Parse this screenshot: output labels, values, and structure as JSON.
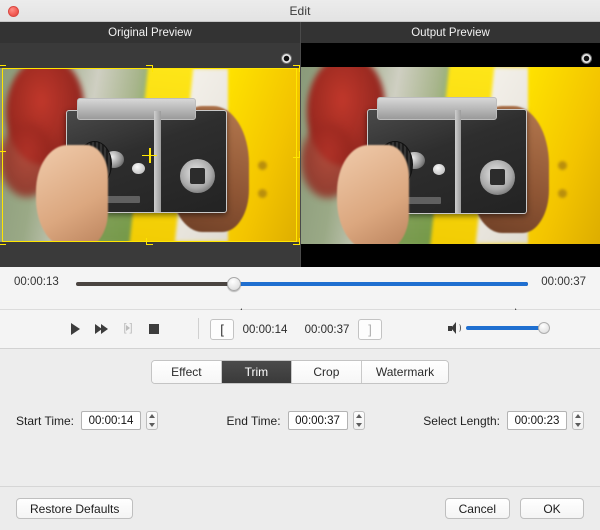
{
  "window": {
    "title": "Edit",
    "close_label": "",
    "close_icon": "close-traffic-light"
  },
  "previews": {
    "original": {
      "header": "Original Preview",
      "crop_overlay": true,
      "crosshair_icon": "crosshair-icon",
      "pin_icon": "rotation-pin-icon"
    },
    "output": {
      "header": "Output Preview",
      "letterboxed": true,
      "pin_icon": "rotation-pin-icon"
    }
  },
  "timeline": {
    "start_label": "00:00:13",
    "end_label": "00:00:37",
    "playhead_percent": 35,
    "fill_start_percent": 35,
    "fill_end_percent": 100,
    "trim_in_percent": 35,
    "trim_out_percent": 99,
    "track_color": "#1f6fd0",
    "base_color": "#4a4440"
  },
  "transport": {
    "buttons": [
      {
        "name": "play-button",
        "icon": "play-icon",
        "enabled": true
      },
      {
        "name": "fast-forward-button",
        "icon": "fast-forward-icon",
        "enabled": true
      },
      {
        "name": "step-frame-button",
        "icon": "step-frame-icon",
        "enabled": false
      },
      {
        "name": "stop-button",
        "icon": "stop-icon",
        "enabled": true
      }
    ],
    "mark_in_label": "[",
    "mark_out_label": "]",
    "in_time": "00:00:14",
    "out_time": "00:00:37",
    "volume_icon": "speaker-icon",
    "volume_percent": 100
  },
  "tabs": {
    "items": [
      {
        "label": "Effect",
        "active": false
      },
      {
        "label": "Trim",
        "active": true
      },
      {
        "label": "Crop",
        "active": false
      },
      {
        "label": "Watermark",
        "active": false
      }
    ]
  },
  "form": {
    "start_time": {
      "label": "Start Time:",
      "value": "00:00:14"
    },
    "end_time": {
      "label": "End Time:",
      "value": "00:00:37"
    },
    "select_length": {
      "label": "Select Length:",
      "value": "00:00:23"
    }
  },
  "footer": {
    "restore_defaults": "Restore Defaults",
    "cancel": "Cancel",
    "ok": "OK"
  },
  "colors": {
    "accent": "#1f6fd0",
    "crop_outline": "#ffe600",
    "active_tab_bg": "#3f3f3f",
    "panel_bg": "#ededed",
    "preview_bg": "#333333"
  }
}
